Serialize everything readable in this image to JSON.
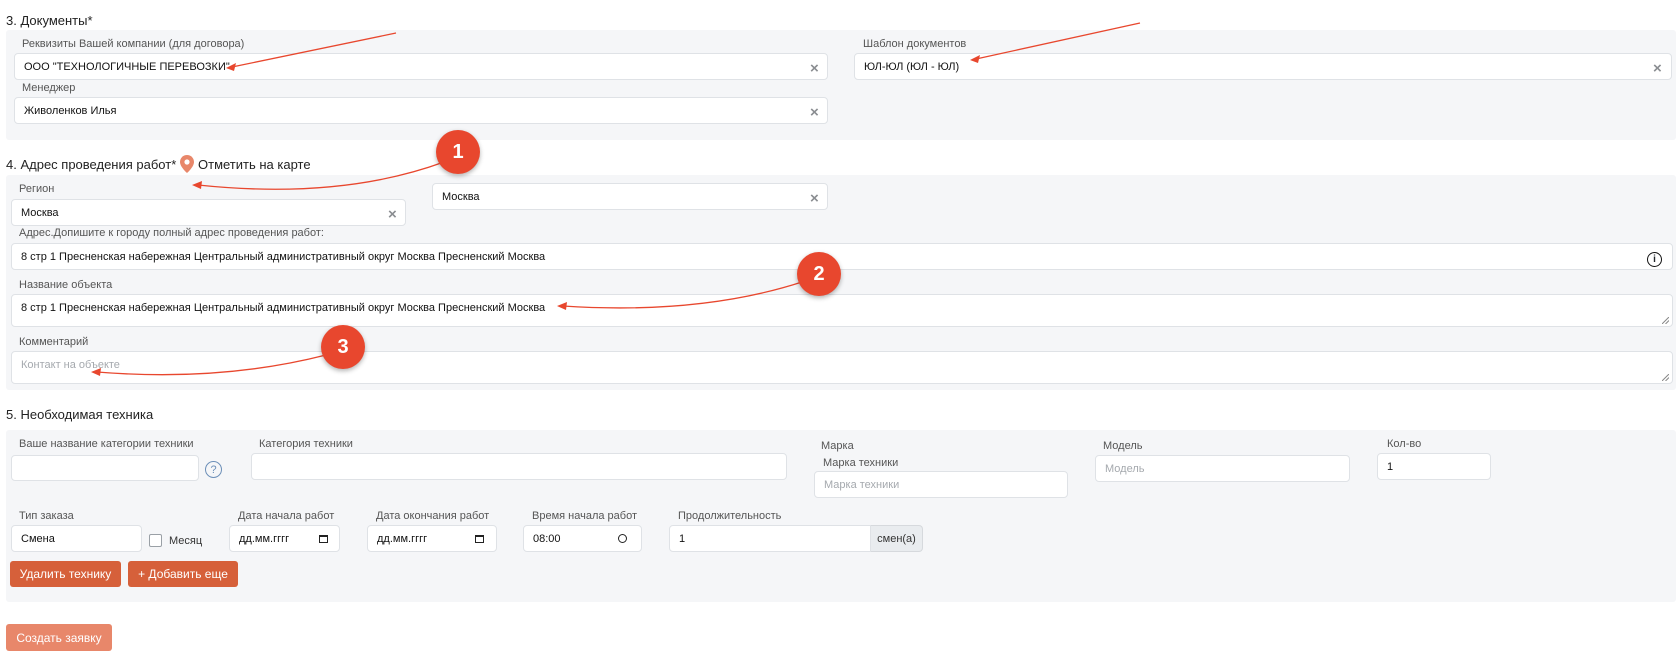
{
  "colors": {
    "accent": "#d6603a",
    "annotation": "#e8472e"
  },
  "section3": {
    "title": "3. Документы*",
    "company_label": "Реквизиты Вашей компании (для договора)",
    "company_value": "ООО \"ТЕХНОЛОГИЧНЫЕ ПЕРЕВОЗКИ\"",
    "template_label": "Шаблон документов",
    "template_value": "ЮЛ-ЮЛ (ЮЛ - ЮЛ)",
    "manager_label": "Менеджер",
    "manager_value": "Живоленков Илья"
  },
  "section4": {
    "title": "4. Адрес проведения работ*",
    "map_link": "Отметить на карте",
    "region_label": "Регион",
    "region_value": "Москва",
    "city_value": "Москва",
    "address_label": "Адрес.Допишите к городу полный адрес проведения работ:",
    "address_value": "8 стр 1 Пресненская набережная Центральный административный округ Москва Пресненский Москва",
    "object_label": "Название объекта",
    "object_value": "8 стр 1 Пресненская набережная Центральный административный округ Москва Пресненский Москва",
    "comment_label": "Комментарий",
    "comment_placeholder": "Контакт на объекте"
  },
  "section5": {
    "title": "5. Необходимая техника",
    "custom_category_label": "Ваше название категории техники",
    "category_label": "Категория техники",
    "brand_label": "Марка",
    "brand_sublabel": "Марка техники",
    "brand_placeholder": "Марка техники",
    "model_label": "Модель",
    "model_placeholder": "Модель",
    "qty_label": "Кол-во",
    "qty_value": "1",
    "order_type_label": "Тип заказа",
    "order_type_value": "Смена",
    "month_label": "Месяц",
    "start_date_label": "Дата начала работ",
    "start_date_value": "дд.мм.гггг",
    "end_date_label": "Дата окончания работ",
    "end_date_value": "дд.мм.гггг",
    "start_time_label": "Время начала работ",
    "start_time_value": "08:00",
    "duration_label": "Продолжительность",
    "duration_value": "1",
    "duration_unit": "смен(а)",
    "delete_button": "Удалить технику",
    "add_button": "+ Добавить еще"
  },
  "submit_button": "Создать заявку",
  "annotations": [
    "1",
    "2",
    "3"
  ],
  "icons": {
    "clear": "×",
    "help": "?",
    "info": "i",
    "map_pin": "map-pin-icon"
  }
}
